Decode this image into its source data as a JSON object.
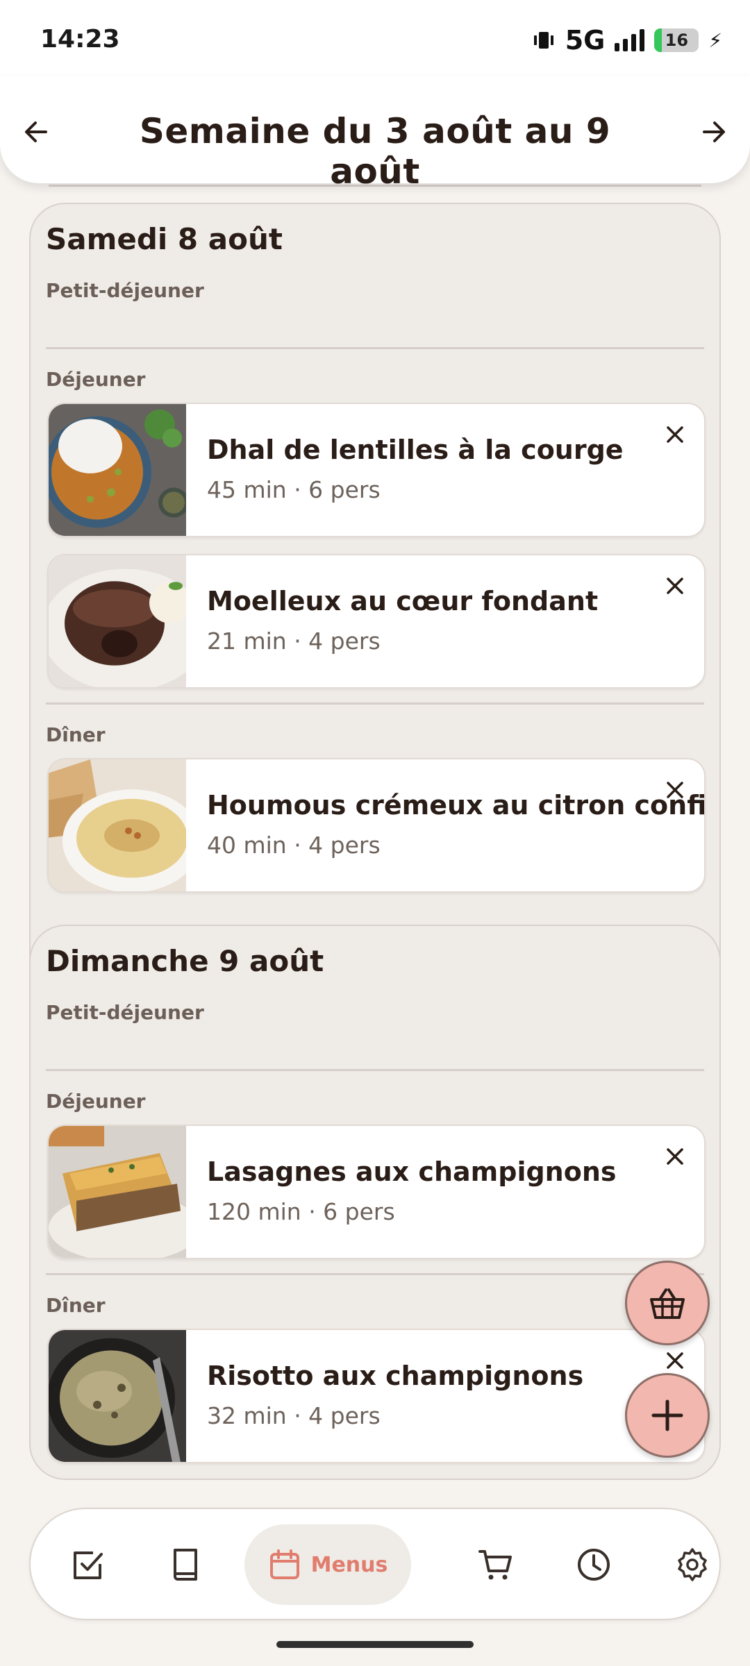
{
  "status_bar": {
    "time": "14:23",
    "network": "5G",
    "battery": "16",
    "battery_level": 0.16
  },
  "header": {
    "title": "Semaine du 3 août au 9 août"
  },
  "days": [
    {
      "title": "Samedi 8 août",
      "meals": [
        {
          "label": "Petit-déjeuner",
          "recipes": []
        },
        {
          "label": "Déjeuner",
          "recipes": [
            {
              "name": "Dhal de lentilles à la courge",
              "meta": "45 min · 6 pers"
            },
            {
              "name": "Moelleux au cœur fondant",
              "meta": "21 min · 4 pers"
            }
          ]
        },
        {
          "label": "Dîner",
          "recipes": [
            {
              "name": "Houmous crémeux au citron confit",
              "meta": "40 min · 4 pers"
            }
          ]
        }
      ]
    },
    {
      "title": "Dimanche 9 août",
      "meals": [
        {
          "label": "Petit-déjeuner",
          "recipes": []
        },
        {
          "label": "Déjeuner",
          "recipes": [
            {
              "name": "Lasagnes aux champignons",
              "meta": "120 min · 6 pers"
            }
          ]
        },
        {
          "label": "Dîner",
          "recipes": [
            {
              "name": "Risotto aux champignons",
              "meta": "32 min · 4 pers"
            }
          ]
        }
      ]
    }
  ],
  "bottom_nav": {
    "items": [
      {
        "icon": "checkbox-icon"
      },
      {
        "icon": "book-icon"
      },
      {
        "icon": "calendar-icon",
        "label": "Menus",
        "active": true
      },
      {
        "icon": "cart-icon"
      },
      {
        "icon": "clock-icon"
      },
      {
        "icon": "gear-icon"
      }
    ]
  },
  "colors": {
    "accent": "#e07d6e",
    "fab": "#f2b7ae",
    "card_bg": "#efebe6",
    "text": "#2a1d17"
  }
}
